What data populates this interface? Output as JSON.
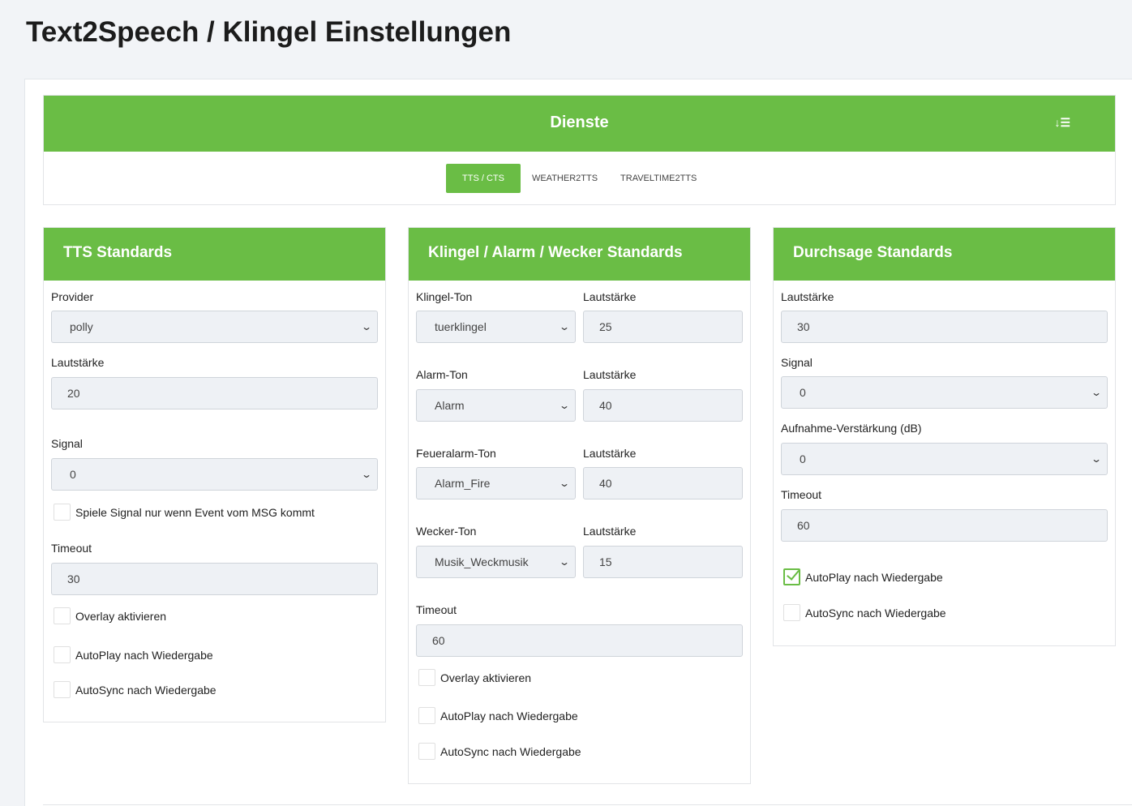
{
  "page_title": "Text2Speech / Klingel Einstellungen",
  "services": {
    "title": "Dienste",
    "sort_icon": "sort-icon",
    "tabs": [
      {
        "label": "TTS / CTS",
        "active": true
      },
      {
        "label": "WEATHER2TTS"
      },
      {
        "label": "TRAVELTIME2TTS"
      }
    ]
  },
  "tts": {
    "title": "TTS Standards",
    "provider_label": "Provider",
    "provider": "polly",
    "volume_label": "Lautstärke",
    "volume": "20",
    "signal_label": "Signal",
    "signal": "0",
    "signal_msg": "Spiele Signal nur wenn Event vom MSG kommt",
    "timeout_label": "Timeout",
    "timeout": "30",
    "overlay": "Overlay aktivieren",
    "autoplay": "AutoPlay nach Wiedergabe",
    "autosync": "AutoSync nach Wiedergabe"
  },
  "bell": {
    "title": "Klingel / Alarm / Wecker Standards",
    "volume_label": "Lautstärke",
    "rows": [
      {
        "label": "Klingel-Ton",
        "sound": "tuerklingel",
        "volume": "25"
      },
      {
        "label": "Alarm-Ton",
        "sound": "Alarm",
        "volume": "40"
      },
      {
        "label": "Feueralarm-Ton",
        "sound": "Alarm_Fire",
        "volume": "40"
      },
      {
        "label": "Wecker-Ton",
        "sound": "Musik_Weckmusik",
        "volume": "15"
      }
    ],
    "timeout_label": "Timeout",
    "timeout": "60",
    "overlay": "Overlay aktivieren",
    "autoplay": "AutoPlay nach Wiedergabe",
    "autosync": "AutoSync nach Wiedergabe"
  },
  "announce": {
    "title": "Durchsage Standards",
    "volume_label": "Lautstärke",
    "volume": "30",
    "signal_label": "Signal",
    "signal": "0",
    "gain_label": "Aufnahme-Verstärkung (dB)",
    "gain": "0",
    "timeout_label": "Timeout",
    "timeout": "60",
    "autoplay": "AutoPlay nach Wiedergabe",
    "autoplay_checked": true,
    "autosync": "AutoSync nach Wiedergabe"
  }
}
